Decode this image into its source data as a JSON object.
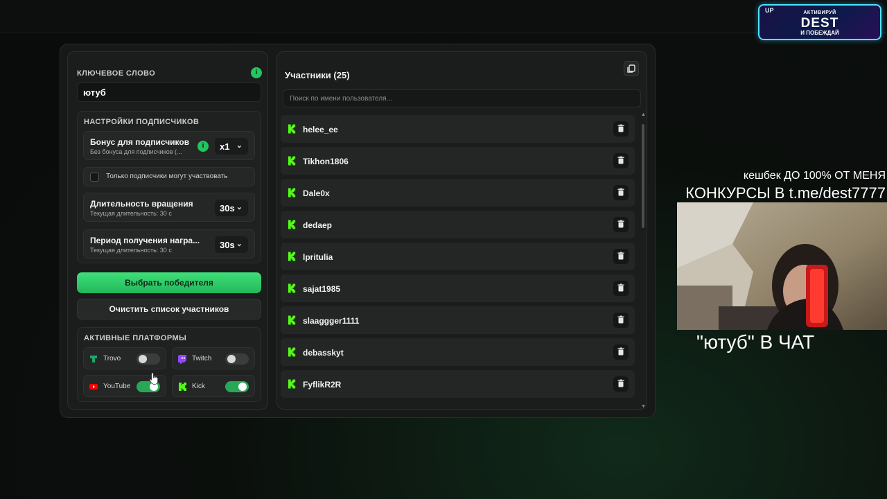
{
  "promo": {
    "corner": "UP",
    "line1": "АКТИВИРУЙ",
    "line2": "DEST",
    "line3": "И ПОБЕЖДАЙ"
  },
  "keyword": {
    "label": "КЛЮЧЕВОЕ СЛОВО",
    "value": "ютуб",
    "info": "i"
  },
  "subscribers": {
    "title": "НАСТРОЙКИ ПОДПИСЧИКОВ",
    "bonus": {
      "title": "Бонус для подписчиков",
      "subtitle": "Без бонуса для подписчиков (...",
      "value": "x1",
      "info": "i"
    },
    "only_subs": {
      "label": "Только подписчики могут участвовать",
      "checked": false
    },
    "spin": {
      "title": "Длительность вращения",
      "subtitle": "Текущая длительность: 30 с",
      "value": "30s"
    },
    "reward": {
      "title": "Период получения награ...",
      "subtitle": "Текущая длительность: 30 с",
      "value": "30s"
    }
  },
  "buttons": {
    "pick_winner": "Выбрать победителя",
    "clear_list": "Очистить список участников"
  },
  "platforms": {
    "title": "АКТИВНЫЕ ПЛАТФОРМЫ",
    "items": [
      {
        "name": "Trovo",
        "enabled": false,
        "icon": "trovo-icon",
        "color": "#19a86b"
      },
      {
        "name": "Twitch",
        "enabled": false,
        "icon": "twitch-icon",
        "color": "#9146ff"
      },
      {
        "name": "YouTube",
        "enabled": true,
        "icon": "youtube-icon",
        "color": "#ff0000"
      },
      {
        "name": "Kick",
        "enabled": true,
        "icon": "kick-icon",
        "color": "#53fc18"
      }
    ]
  },
  "participants": {
    "title": "Участники (25)",
    "search_placeholder": "Поиск по имени пользователя...",
    "items": [
      "helee_ee",
      "Tikhon1806",
      "Dale0x",
      "dedaep",
      "lpritulia",
      "sajat1985",
      "slaaggger1111",
      "debasskyt",
      "FyflikR2R"
    ]
  },
  "overlay": {
    "line1": "кешбек ДО 100% ОТ МЕНЯ",
    "line2": "КОНКУРСЫ В t.me/dest7777",
    "line3": "\"ютуб\" В ЧАТ"
  },
  "colors": {
    "accent": "#22c55e",
    "kick": "#53fc18",
    "panel": "#171918"
  }
}
